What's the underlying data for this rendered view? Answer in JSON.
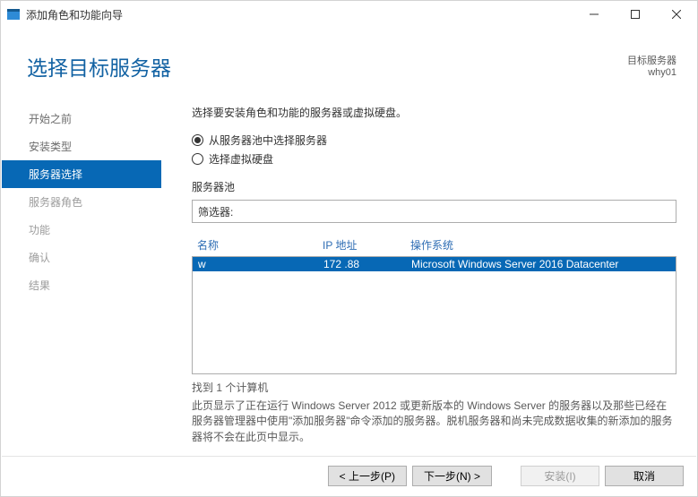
{
  "window": {
    "title": "添加角色和功能向导"
  },
  "header": {
    "title": "选择目标服务器",
    "destination_label": "目标服务器",
    "destination_name": "why01"
  },
  "steps": {
    "items": [
      {
        "label": "开始之前",
        "state": "done"
      },
      {
        "label": "安装类型",
        "state": "done"
      },
      {
        "label": "服务器选择",
        "state": "active"
      },
      {
        "label": "服务器角色",
        "state": "upcoming"
      },
      {
        "label": "功能",
        "state": "upcoming"
      },
      {
        "label": "确认",
        "state": "upcoming"
      },
      {
        "label": "结果",
        "state": "upcoming"
      }
    ]
  },
  "pane": {
    "instruction": "选择要安装角色和功能的服务器或虚拟硬盘。",
    "radio_pool": "从服务器池中选择服务器",
    "radio_vhd": "选择虚拟硬盘",
    "radio_selected": "pool",
    "pool_label": "服务器池",
    "filter_label": "筛选器:",
    "filter_value": "",
    "columns": {
      "name": "名称",
      "ip": "IP 地址",
      "os": "操作系统"
    },
    "rows": [
      {
        "name": "w",
        "ip": "172            .88",
        "os": "Microsoft Windows Server 2016 Datacenter"
      }
    ],
    "found_text": "找到 1 个计算机",
    "description": "此页显示了正在运行 Windows Server 2012 或更新版本的 Windows Server 的服务器以及那些已经在服务器管理器中使用\"添加服务器\"命令添加的服务器。脱机服务器和尚未完成数据收集的新添加的服务器将不会在此页中显示。"
  },
  "buttons": {
    "previous": "< 上一步(P)",
    "next": "下一步(N) >",
    "install": "安装(I)",
    "cancel": "取消"
  }
}
